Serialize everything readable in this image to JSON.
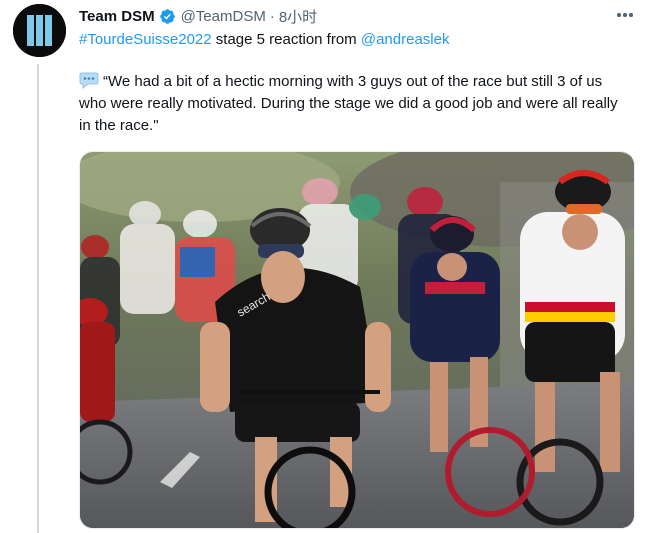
{
  "tweet": {
    "display_name": "Team DSM",
    "handle": "@TeamDSM",
    "separator": "·",
    "timestamp": "8小时",
    "hashtag": "#TourdeSuisse2022",
    "subline_middle": " stage 5 reaction from ",
    "mention": "@andreaslek",
    "quote_text": "“We had a bit of a hectic morning with 3 guys out of the race but still 3 of us who were really motivated. During the stage we did a good job and were all really in the race.\"",
    "verified_color": "#1d9bf0",
    "link_color": "#1d9bf0",
    "icons": {
      "verified": "verified-badge-icon",
      "more": "more-options-icon",
      "speech": "speech-balloon-icon",
      "avatar": "team-dsm-logo"
    }
  },
  "photo": {
    "subject": "road-cycling-peloton"
  }
}
